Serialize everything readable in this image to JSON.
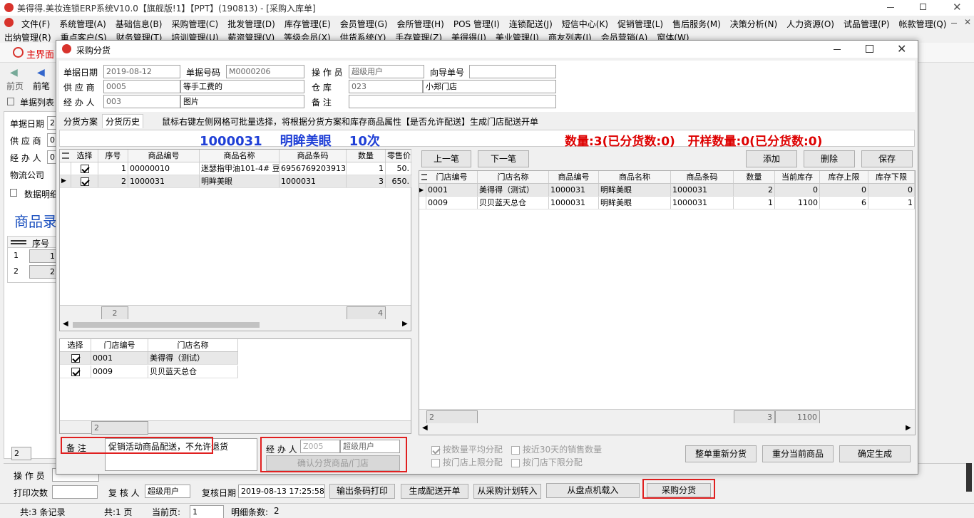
{
  "app": {
    "title": "美得得.美妆连锁ERP系统V10.0【旗舰版!1】【PPT】(190813) - [采购入库单]",
    "menu1": [
      "文件(F)",
      "系统管理(A)",
      "基础信息(B)",
      "采购管理(C)",
      "批发管理(D)",
      "库存管理(E)",
      "会员管理(G)",
      "会所管理(H)",
      "POS 管理(I)",
      "连锁配送(J)",
      "短信中心(K)",
      "促销管理(L)",
      "售后服务(M)",
      "决策分析(N)",
      "人力资源(O)",
      "试品管理(P)",
      "帐款管理(Q)"
    ],
    "menu2": [
      "出纳管理(R)",
      "重点客户(S)",
      "财务管理(T)",
      "培训管理(U)",
      "薪资管理(V)",
      "等级会员(X)",
      "供货系统(Y)",
      "手存管理(Z)",
      "美得得(J)",
      "美业管理(J)",
      "商友列表(I)",
      "会员营销(A)",
      "窗体(W)"
    ],
    "home_tab": "主界面",
    "nav_prev": "前页",
    "nav_prev2": "前笔",
    "list_tab": "单据列表",
    "bg_labels": {
      "date": "单据日期",
      "supplier": "供 应 商",
      "handler": "经 办 人",
      "logistics": "物流公司",
      "detail": "数据明细",
      "goods": "商品录",
      "seq": "序号"
    },
    "bg_rows": [
      {
        "idx": "1",
        "val": "1"
      },
      {
        "idx": "2",
        "val": "2"
      }
    ],
    "bg_foot": "2",
    "footer": {
      "operator_label": "操 作 员",
      "print_label": "打印次数",
      "reviewer_label": "复 核 人",
      "reviewer": "超级用户",
      "review_date_label": "复核日期",
      "review_date": "2019-08-13 17:25:58",
      "btn_barcode": "输出条码打印",
      "btn_gen": "生成配送开单",
      "btn_plan": "从采购计划转入",
      "btn_count": "从盘点机载入",
      "btn_distribute": "采购分货"
    },
    "status": {
      "records": "共:3 条记录",
      "pages": "共:1 页",
      "cur_label": "当前页:",
      "cur": "1",
      "detail": "明细条数:",
      "detail_n": "2"
    }
  },
  "dialog": {
    "title": "采购分货",
    "form": {
      "date_label": "单据日期",
      "date": "2019-08-12",
      "no_label": "单据号码",
      "no": "M0000206",
      "op_label": "操 作 员",
      "op": "超级用户",
      "guide_label": "向导单号",
      "guide": "",
      "supplier_label": "供 应 商",
      "supplier_code": "0005",
      "supplier_name": "等手工费的",
      "warehouse_label": "仓    库",
      "warehouse_code": "023",
      "warehouse_name": "小郑门店",
      "handler_label": "经 办 人",
      "handler_code": "003",
      "handler_name": "图片",
      "remark_label": "备    注",
      "remark": ""
    },
    "tabs": [
      "分货方案",
      "分货历史"
    ],
    "hint": "鼠标右键左侧网格可批量选择，将根据分货方案和库存商品属性【是否允许配送】生成门店配送开单",
    "banner_left": "1000031    明眸美眼    10次",
    "banner_right": "数量:3(已分货数:0)   开样数量:0(已分货数:0)",
    "left_grid": {
      "headers": [
        "选择",
        "序号",
        "商品编号",
        "商品名称",
        "商品条码",
        "数量",
        "零售价"
      ],
      "rows": [
        {
          "sel": true,
          "seq": "1",
          "code": "00000010",
          "name": "迷瑟指甲油101-4# 豆",
          "barcode": "6956769203913",
          "qty": "1",
          "price": "50."
        },
        {
          "sel": true,
          "seq": "2",
          "code": "1000031",
          "name": "明眸美眼",
          "barcode": "1000031",
          "qty": "3",
          "price": "650."
        }
      ],
      "foot_count": "2",
      "foot_qty": "4"
    },
    "store_grid": {
      "headers": [
        "选择",
        "门店编号",
        "门店名称"
      ],
      "rows": [
        {
          "sel": true,
          "code": "0001",
          "name": "美得得（测试）"
        },
        {
          "sel": true,
          "code": "0009",
          "name": "贝贝蓝天总仓"
        }
      ],
      "foot": "2"
    },
    "right_buttons": {
      "prev": "上一笔",
      "next": "下一笔",
      "add": "添加",
      "delete": "删除",
      "save": "保存"
    },
    "right_grid": {
      "headers": [
        "门店编号",
        "门店名称",
        "商品编号",
        "商品名称",
        "商品条码",
        "数量",
        "当前库存",
        "库存上限",
        "库存下限"
      ],
      "rows": [
        {
          "store": "0001",
          "store_name": "美得得（测试）",
          "code": "1000031",
          "name": "明眸美眼",
          "barcode": "1000031",
          "qty": "2",
          "stock": "0",
          "upper": "0",
          "lower": "0"
        },
        {
          "store": "0009",
          "store_name": "贝贝蓝天总仓",
          "code": "1000031",
          "name": "明眸美眼",
          "barcode": "1000031",
          "qty": "1",
          "stock": "1100",
          "upper": "6",
          "lower": "1"
        }
      ],
      "foot_count": "2",
      "foot_qty": "3",
      "foot_stock": "1100"
    },
    "bottom": {
      "remark_label": "备    注",
      "remark": "促销活动商品配送，不允许退货",
      "handler_label": "经 办 人",
      "handler_code": "Z005",
      "handler_name": "超级用户",
      "confirm_btn": "确认分货商品/门店",
      "opt_avg": "按数量平均分配",
      "opt_30": "按近30天的销售数量",
      "opt_upper": "按门店上限分配",
      "opt_lower": "按门店下限分配",
      "btn_redo_all": "整单重新分货",
      "btn_redo_cur": "重分当前商品",
      "btn_confirm": "确定生成"
    }
  }
}
